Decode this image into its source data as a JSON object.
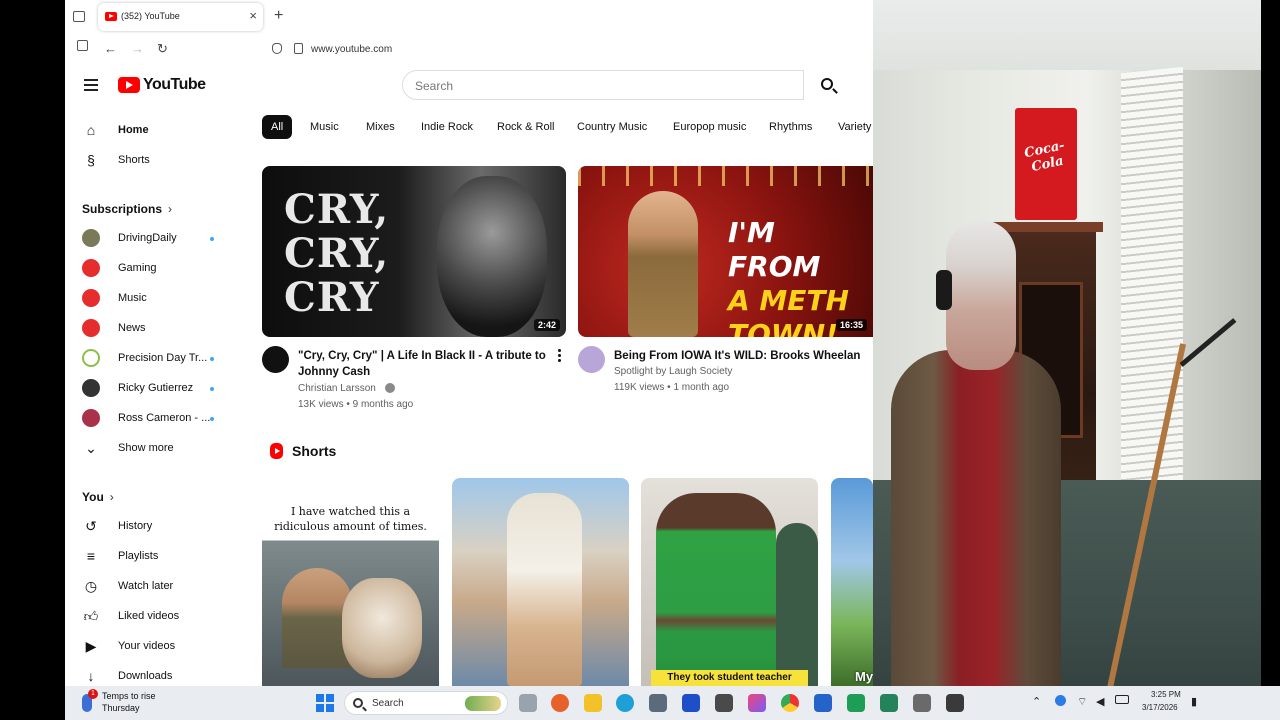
{
  "browser": {
    "tab_title": "(352) YouTube",
    "tab_close": "×",
    "new_tab": "+",
    "url": "www.youtube.com",
    "nav_back": "←",
    "nav_forward": "→",
    "nav_reload": "↻"
  },
  "header": {
    "logo_text": "YouTube",
    "search_placeholder": "Search"
  },
  "sidebar": {
    "main": [
      {
        "label": "Home",
        "icon": "home-icon"
      },
      {
        "label": "Shorts",
        "icon": "shorts-icon"
      }
    ],
    "subscriptions_title": "Subscriptions",
    "subscriptions_chevron": "›",
    "subscriptions": [
      {
        "label": "DrivingDaily",
        "color": "#7a7a58"
      },
      {
        "label": "Gaming",
        "color": "#e52d2d"
      },
      {
        "label": "Music",
        "color": "#e52d2d"
      },
      {
        "label": "News",
        "color": "#e52d2d"
      },
      {
        "label": "Precision Day Tr...",
        "color": "#8ac04a"
      },
      {
        "label": "Ricky Gutierrez",
        "color": "#333333"
      },
      {
        "label": "Ross Cameron - ...",
        "color": "#a8324a"
      }
    ],
    "show_more": "Show more",
    "you_title": "You",
    "you_items": [
      {
        "label": "History",
        "icon": "history-icon"
      },
      {
        "label": "Playlists",
        "icon": "playlists-icon"
      },
      {
        "label": "Watch later",
        "icon": "watch-later-icon"
      },
      {
        "label": "Liked videos",
        "icon": "thumbs-up-icon"
      },
      {
        "label": "Your videos",
        "icon": "your-videos-icon"
      },
      {
        "label": "Downloads",
        "icon": "download-icon"
      }
    ]
  },
  "chips": [
    "All",
    "Music",
    "Mixes",
    "Indie Rock",
    "Rock & Roll",
    "Country Music",
    "Europop music",
    "Rhythms",
    "Variety"
  ],
  "videos": [
    {
      "thumb_text": "CRY,\nCRY,\nCRY",
      "duration": "2:42",
      "title_line1": "\"Cry, Cry, Cry\" | A Life In Black II - A tribute to",
      "title_line2": "Johnny Cash",
      "channel": "Christian Larsson",
      "meta": "13K views • 9 months ago"
    },
    {
      "thumb_text_white": "I'M FROM",
      "thumb_text_yellow": "A METH",
      "thumb_text_yellow2": "TOWN!",
      "duration": "16:35",
      "title_line1": "Being From IOWA It's WILD: Brooks Wheelan",
      "channel": "Spotlight by Laugh Society",
      "meta": "119K views • 1 month ago"
    }
  ],
  "shorts": {
    "title": "Shorts",
    "items": [
      {
        "caption": "I have watched this a ridiculous amount of times."
      },
      {
        "caption": ""
      },
      {
        "caption": "They took student teacher"
      },
      {
        "caption": "My"
      }
    ]
  },
  "webcam": {
    "sign_text": "Coca-Cola"
  },
  "taskbar": {
    "weather_line1": "Temps to rise",
    "weather_line2": "Thursday",
    "weather_badge": "1",
    "search_label": "Search",
    "time": "3:25 PM",
    "date": "3/17/2026"
  }
}
